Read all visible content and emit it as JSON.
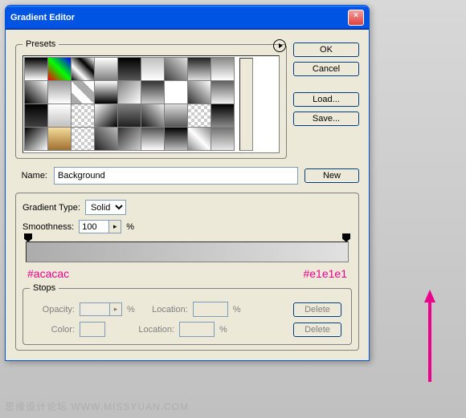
{
  "title": "Gradient Editor",
  "presets_label": "Presets",
  "buttons": {
    "ok": "OK",
    "cancel": "Cancel",
    "load": "Load...",
    "save": "Save...",
    "new": "New",
    "delete": "Delete"
  },
  "name_label": "Name:",
  "name_value": "Background",
  "gradient_type_label": "Gradient Type:",
  "gradient_type_value": "Solid",
  "smoothness_label": "Smoothness:",
  "smoothness_value": "100",
  "percent": "%",
  "stops_label": "Stops",
  "opacity_label": "Opacity:",
  "location_label": "Location:",
  "color_label": "Color:",
  "color_left": "#acacac",
  "color_right": "#e1e1e1",
  "watermark": "思缘设计论坛   WWW.MISSYUAN.COM",
  "swatches": [
    "linear-gradient(#000,#fff)",
    "linear-gradient(45deg,#f00,#0f0,#00f)",
    "linear-gradient(45deg,#000,#fff,#000,#fff)",
    "linear-gradient(#fff,#808080)",
    "linear-gradient(#000,#555)",
    "linear-gradient(#c0c0c0,#fff)",
    "linear-gradient(45deg,#404040,#e0e0e0)",
    "linear-gradient(#222,#ddd)",
    "linear-gradient(#888,#fff)",
    "linear-gradient(45deg,#000,#fff)",
    "linear-gradient(#999,#fff)",
    "linear-gradient(45deg,#aaa 25%,#fff 25%,#fff 50%,#aaa 50%,#aaa 75%,#fff 75%)",
    "linear-gradient(#fff,#000)",
    "linear-gradient(135deg,#808080,#fff)",
    "linear-gradient(#333,#ccc)",
    "linear-gradient(#fff,#fff)",
    "linear-gradient(45deg,#303030,#fff)",
    "linear-gradient(#606060,#f0f0f0)",
    "linear-gradient(#000,#404040)",
    "linear-gradient(#fff,#c0c0c0)",
    "repeating-conic-gradient(#ccc 0 25%,#fff 0 50%) 0/8px 8px",
    "linear-gradient(135deg,#fff,#000)",
    "linear-gradient(#808080,#202020)",
    "linear-gradient(45deg,#111,#eee)",
    "linear-gradient(#ddd,#555)",
    "repeating-conic-gradient(#ccc 0 25%,#fff 0 50%) 0/8px 8px",
    "linear-gradient(#000,#888)",
    "linear-gradient(135deg,#000,#fff)",
    "linear-gradient(#f5dc9a,#a07030)",
    "repeating-conic-gradient(#ccc 0 25%,#fff 0 50%) 0/8px 8px",
    "linear-gradient(45deg,#222,#bbb)",
    "linear-gradient(135deg,#303030,#d0d0d0)",
    "linear-gradient(#505050,#fff)",
    "linear-gradient(#000,#c0c0c0)",
    "linear-gradient(45deg,#888,#fff,#888)",
    "linear-gradient(#707070,#e8e8e8)"
  ]
}
